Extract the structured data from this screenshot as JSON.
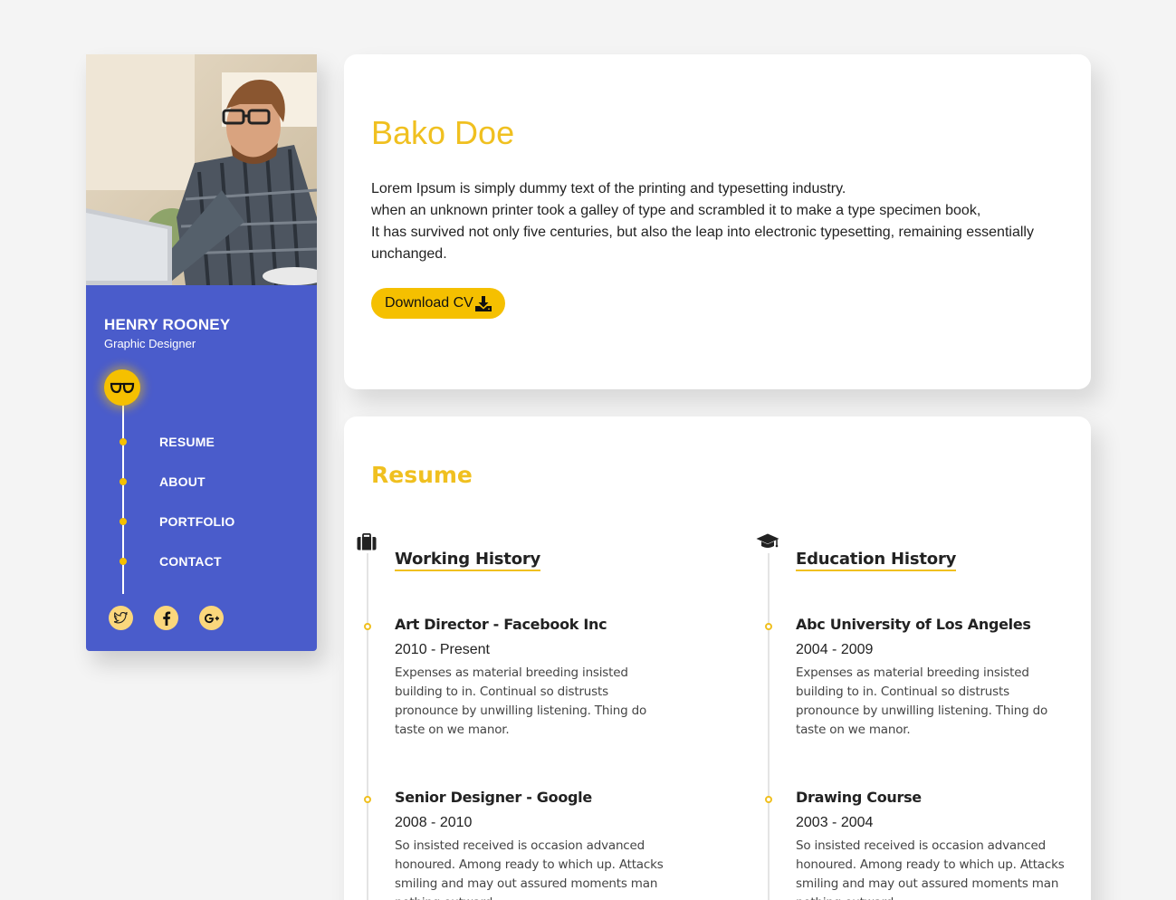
{
  "sidebar": {
    "name": "HENRY ROONEY",
    "role": "Graphic Designer",
    "badge_icon": "glasses-icon",
    "nav": [
      {
        "label": "RESUME"
      },
      {
        "label": "ABOUT"
      },
      {
        "label": "PORTFOLIO"
      },
      {
        "label": "CONTACT"
      }
    ],
    "socials": [
      "twitter-icon",
      "facebook-icon",
      "google-plus-icon"
    ]
  },
  "hero": {
    "name": "Bako Doe",
    "lines": [
      "Lorem Ipsum is simply dummy text of the printing and typesetting industry.",
      "when an unknown printer took a galley of type and scrambled it to make a type specimen book,",
      "It has survived not only five centuries, but also the leap into electronic typesetting, remaining essentially unchanged."
    ],
    "download_label": "Download CV"
  },
  "resume": {
    "title": "Resume",
    "work": {
      "heading": "Working History",
      "icon": "briefcase-icon",
      "entries": [
        {
          "title": "Art Director - Facebook Inc",
          "date": "2010 - Present",
          "desc": "Expenses as material breeding insisted building to in. Continual so distrusts pronounce by unwilling listening. Thing do taste on we manor."
        },
        {
          "title": "Senior Designer - Google",
          "date": "2008 - 2010",
          "desc": "So insisted received is occasion advanced honoured. Among ready to which up. Attacks smiling and may out assured moments man nothing outward."
        }
      ]
    },
    "education": {
      "heading": "Education History",
      "icon": "graduation-cap-icon",
      "entries": [
        {
          "title": "Abc University of Los Angeles",
          "date": "2004 - 2009",
          "desc": "Expenses as material breeding insisted building to in. Continual so distrusts pronounce by unwilling listening. Thing do taste on we manor."
        },
        {
          "title": "Drawing Course",
          "date": "2003 - 2004",
          "desc": "So insisted received is occasion advanced honoured. Among ready to which up. Attacks smiling and may out assured moments man nothing outward."
        }
      ]
    }
  },
  "colors": {
    "accent": "#f5c000",
    "sidebar_bg": "#4a5ccb",
    "page_bg": "#f4f4f4"
  }
}
